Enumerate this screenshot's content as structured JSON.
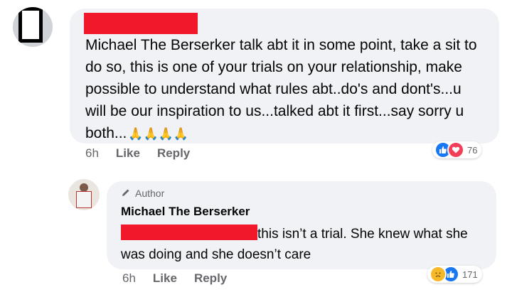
{
  "comment1": {
    "text": "Michael The Berserker talk abt it in some point, take a sit to do so, this is one of your trials on your relationship, make possible to understand what  rules abt..do's and dont's...u will be our inspiration to us...talked abt it first...say sorry u both...",
    "emojis": "🙏🙏🙏🙏",
    "time": "6h",
    "like_label": "Like",
    "reply_label": "Reply",
    "reaction_count": "76"
  },
  "reply": {
    "author_badge": "Author",
    "author_name": "Michael The Berserker",
    "text": "this isn’t a trial. She knew what she was doing and she doesn’t care",
    "time": "6h",
    "like_label": "Like",
    "reply_label": "Reply",
    "reaction_count": "171"
  },
  "colors": {
    "redaction": "#f0182a",
    "bubble": "#f0f2f5",
    "like": "#1877f2",
    "love": "#f33e58",
    "sad": "#f7b928"
  },
  "icons": [
    "like-icon",
    "love-icon",
    "sad-icon",
    "pencil-icon",
    "pray-emoji"
  ]
}
